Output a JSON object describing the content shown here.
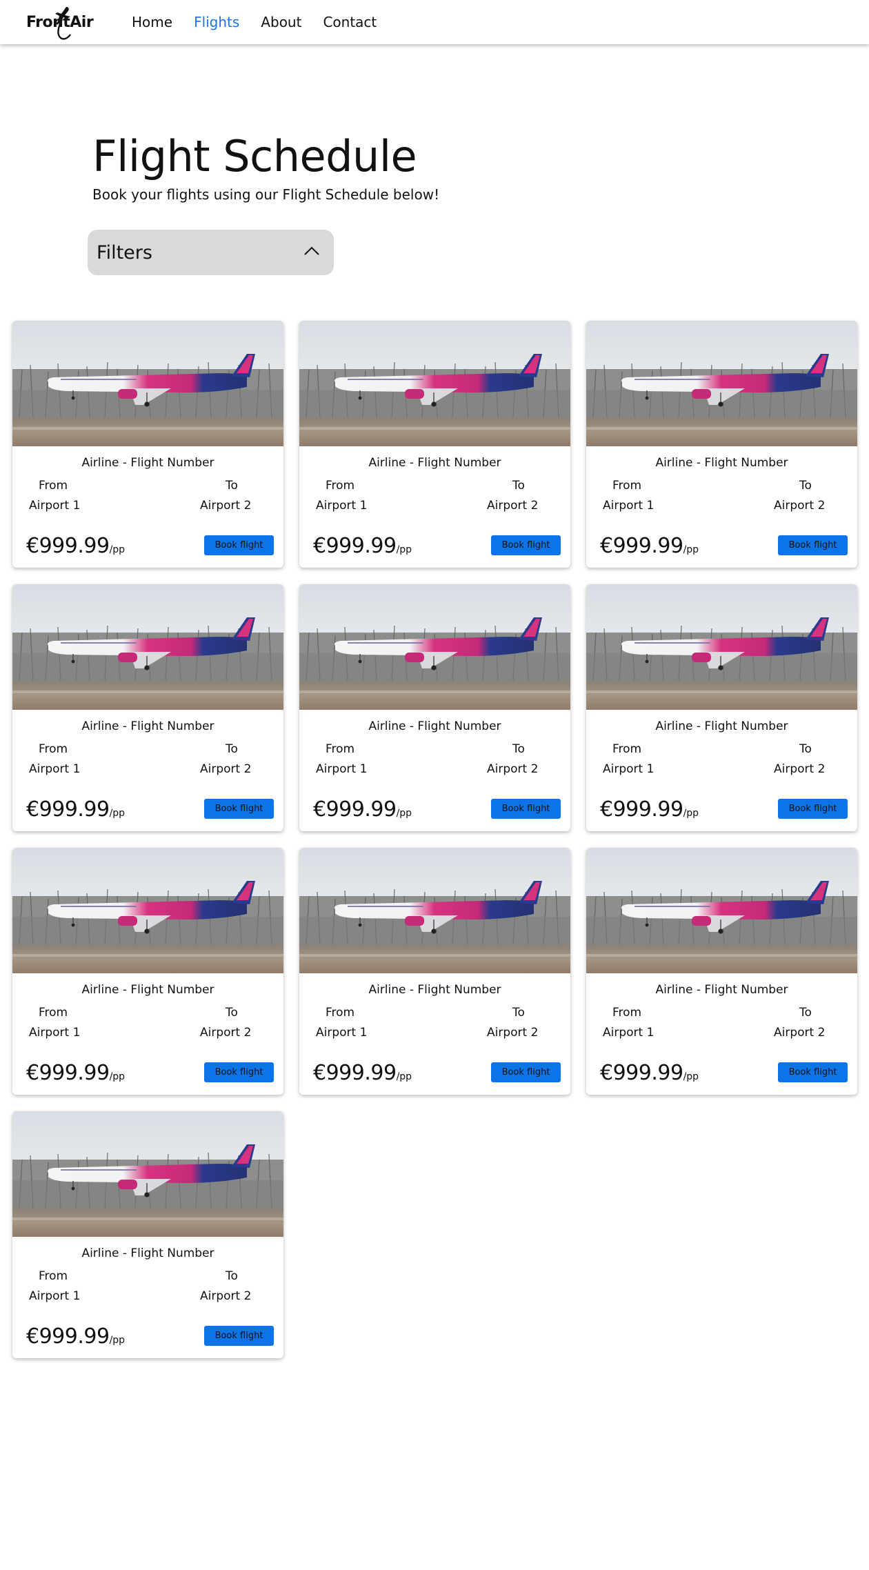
{
  "brand": {
    "logo_text": "FrontAir"
  },
  "nav": {
    "items": [
      {
        "label": "Home",
        "active": false
      },
      {
        "label": "Flights",
        "active": true
      },
      {
        "label": "About",
        "active": false
      },
      {
        "label": "Contact",
        "active": false
      }
    ],
    "active_color": "#1a73e8"
  },
  "header": {
    "title": "Flight Schedule",
    "subtitle": "Book your flights using our Flight Schedule below!"
  },
  "filters": {
    "label": "Filters",
    "icon": "chevron-up-icon",
    "expanded": true
  },
  "flights": [
    {
      "title": "Airline - Flight Number",
      "from_label": "From",
      "from_airport": "Airport 1",
      "to_label": "To",
      "to_airport": "Airport 2",
      "price": "€999.99",
      "price_unit": "/pp",
      "button_label": "Book flight"
    },
    {
      "title": "Airline - Flight Number",
      "from_label": "From",
      "from_airport": "Airport 1",
      "to_label": "To",
      "to_airport": "Airport 2",
      "price": "€999.99",
      "price_unit": "/pp",
      "button_label": "Book flight"
    },
    {
      "title": "Airline - Flight Number",
      "from_label": "From",
      "from_airport": "Airport 1",
      "to_label": "To",
      "to_airport": "Airport 2",
      "price": "€999.99",
      "price_unit": "/pp",
      "button_label": "Book flight"
    },
    {
      "title": "Airline - Flight Number",
      "from_label": "From",
      "from_airport": "Airport 1",
      "to_label": "To",
      "to_airport": "Airport 2",
      "price": "€999.99",
      "price_unit": "/pp",
      "button_label": "Book flight"
    },
    {
      "title": "Airline - Flight Number",
      "from_label": "From",
      "from_airport": "Airport 1",
      "to_label": "To",
      "to_airport": "Airport 2",
      "price": "€999.99",
      "price_unit": "/pp",
      "button_label": "Book flight"
    },
    {
      "title": "Airline - Flight Number",
      "from_label": "From",
      "from_airport": "Airport 1",
      "to_label": "To",
      "to_airport": "Airport 2",
      "price": "€999.99",
      "price_unit": "/pp",
      "button_label": "Book flight"
    },
    {
      "title": "Airline - Flight Number",
      "from_label": "From",
      "from_airport": "Airport 1",
      "to_label": "To",
      "to_airport": "Airport 2",
      "price": "€999.99",
      "price_unit": "/pp",
      "button_label": "Book flight"
    },
    {
      "title": "Airline - Flight Number",
      "from_label": "From",
      "from_airport": "Airport 1",
      "to_label": "To",
      "to_airport": "Airport 2",
      "price": "€999.99",
      "price_unit": "/pp",
      "button_label": "Book flight"
    },
    {
      "title": "Airline - Flight Number",
      "from_label": "From",
      "from_airport": "Airport 1",
      "to_label": "To",
      "to_airport": "Airport 2",
      "price": "€999.99",
      "price_unit": "/pp",
      "button_label": "Book flight"
    },
    {
      "title": "Airline - Flight Number",
      "from_label": "From",
      "from_airport": "Airport 1",
      "to_label": "To",
      "to_airport": "Airport 2",
      "price": "€999.99",
      "price_unit": "/pp",
      "button_label": "Book flight"
    }
  ],
  "colors": {
    "button": "#0d74e7",
    "filters_bg": "#d9d9d9",
    "plane_pink": "#d6337f",
    "plane_blue": "#2a3a8c"
  }
}
